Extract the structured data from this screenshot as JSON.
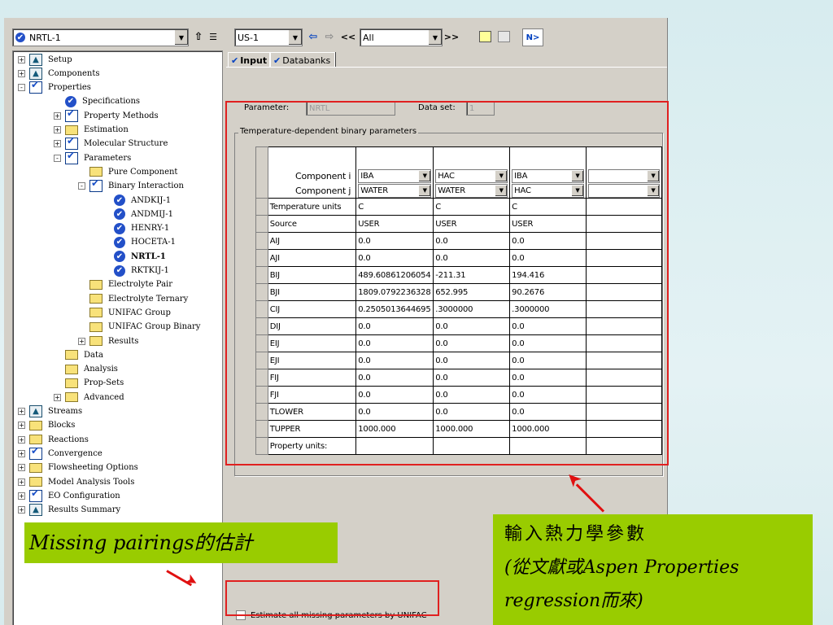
{
  "toolbar": {
    "object_select": "NRTL-1",
    "section_select": "US-1",
    "filter_select": "All",
    "prev_label": "<<",
    "next_label": ">>",
    "next_button": "N>"
  },
  "tree": {
    "nodes": [
      {
        "label": "Setup"
      },
      {
        "label": "Components"
      },
      {
        "label": "Properties"
      },
      {
        "label": "Specifications"
      },
      {
        "label": "Property Methods"
      },
      {
        "label": "Estimation"
      },
      {
        "label": "Molecular Structure"
      },
      {
        "label": "Parameters"
      },
      {
        "label": "Pure Component"
      },
      {
        "label": "Binary Interaction"
      },
      {
        "label": "ANDKIJ-1"
      },
      {
        "label": "ANDMIJ-1"
      },
      {
        "label": "HENRY-1"
      },
      {
        "label": "HOCETA-1"
      },
      {
        "label": "NRTL-1"
      },
      {
        "label": "RKTKIJ-1"
      },
      {
        "label": "Electrolyte Pair"
      },
      {
        "label": "Electrolyte Ternary"
      },
      {
        "label": "UNIFAC Group"
      },
      {
        "label": "UNIFAC Group Binary"
      },
      {
        "label": "Results"
      },
      {
        "label": "Data"
      },
      {
        "label": "Analysis"
      },
      {
        "label": "Prop-Sets"
      },
      {
        "label": "Advanced"
      },
      {
        "label": "Streams"
      },
      {
        "label": "Blocks"
      },
      {
        "label": "Reactions"
      },
      {
        "label": "Convergence"
      },
      {
        "label": "Flowsheeting Options"
      },
      {
        "label": "Model Analysis Tools"
      },
      {
        "label": "EO Configuration"
      },
      {
        "label": "Results Summary"
      }
    ]
  },
  "tabs": {
    "input": "Input",
    "databanks": "Databanks"
  },
  "form": {
    "parameter_label": "Parameter:",
    "parameter_value": "NRTL",
    "dataset_label": "Data set:",
    "dataset_value": "1",
    "group_title": "Temperature-dependent binary parameters"
  },
  "grid": {
    "component_i_label": "Component  i",
    "component_j_label": "Component  j",
    "component_i": [
      "IBA",
      "HAC",
      "IBA",
      ""
    ],
    "component_j": [
      "WATER",
      "WATER",
      "HAC",
      ""
    ],
    "rows": [
      {
        "label": "Temperature units",
        "values": [
          "C",
          "C",
          "C",
          ""
        ]
      },
      {
        "label": "Source",
        "values": [
          "USER",
          "USER",
          "USER",
          ""
        ]
      },
      {
        "label": "AIJ",
        "values": [
          "0.0",
          "0.0",
          "0.0",
          ""
        ]
      },
      {
        "label": "AJI",
        "values": [
          "0.0",
          "0.0",
          "0.0",
          ""
        ]
      },
      {
        "label": "BIJ",
        "values": [
          "489.60861206054",
          "-211.31",
          "194.416",
          ""
        ]
      },
      {
        "label": "BJI",
        "values": [
          "1809.0792236328",
          "652.995",
          "90.2676",
          ""
        ]
      },
      {
        "label": "CIJ",
        "values": [
          "0.2505013644695",
          ".3000000",
          ".3000000",
          ""
        ]
      },
      {
        "label": "DIJ",
        "values": [
          "0.0",
          "0.0",
          "0.0",
          ""
        ]
      },
      {
        "label": "EIJ",
        "values": [
          "0.0",
          "0.0",
          "0.0",
          ""
        ]
      },
      {
        "label": "EJI",
        "values": [
          "0.0",
          "0.0",
          "0.0",
          ""
        ]
      },
      {
        "label": "FIJ",
        "values": [
          "0.0",
          "0.0",
          "0.0",
          ""
        ]
      },
      {
        "label": "FJI",
        "values": [
          "0.0",
          "0.0",
          "0.0",
          ""
        ]
      },
      {
        "label": "TLOWER",
        "values": [
          "0.0",
          "0.0",
          "0.0",
          ""
        ]
      },
      {
        "label": "TUPPER",
        "values": [
          "1000.000",
          "1000.000",
          "1000.000",
          ""
        ]
      },
      {
        "label": "Property units:",
        "values": [
          "",
          "",
          "",
          ""
        ]
      }
    ]
  },
  "unifac_checkbox_label": "Estimate all missing parameters by UNIFAC",
  "annotations": {
    "missing_pairings": "Missing pairings的估計",
    "input_line1": "輸入熱力學參數",
    "input_line2": "(從文獻或Aspen Properties",
    "input_line3": "regression而來)"
  },
  "colors": {
    "callout_bg": "#99cc00",
    "highlight_red": "#e02020"
  }
}
